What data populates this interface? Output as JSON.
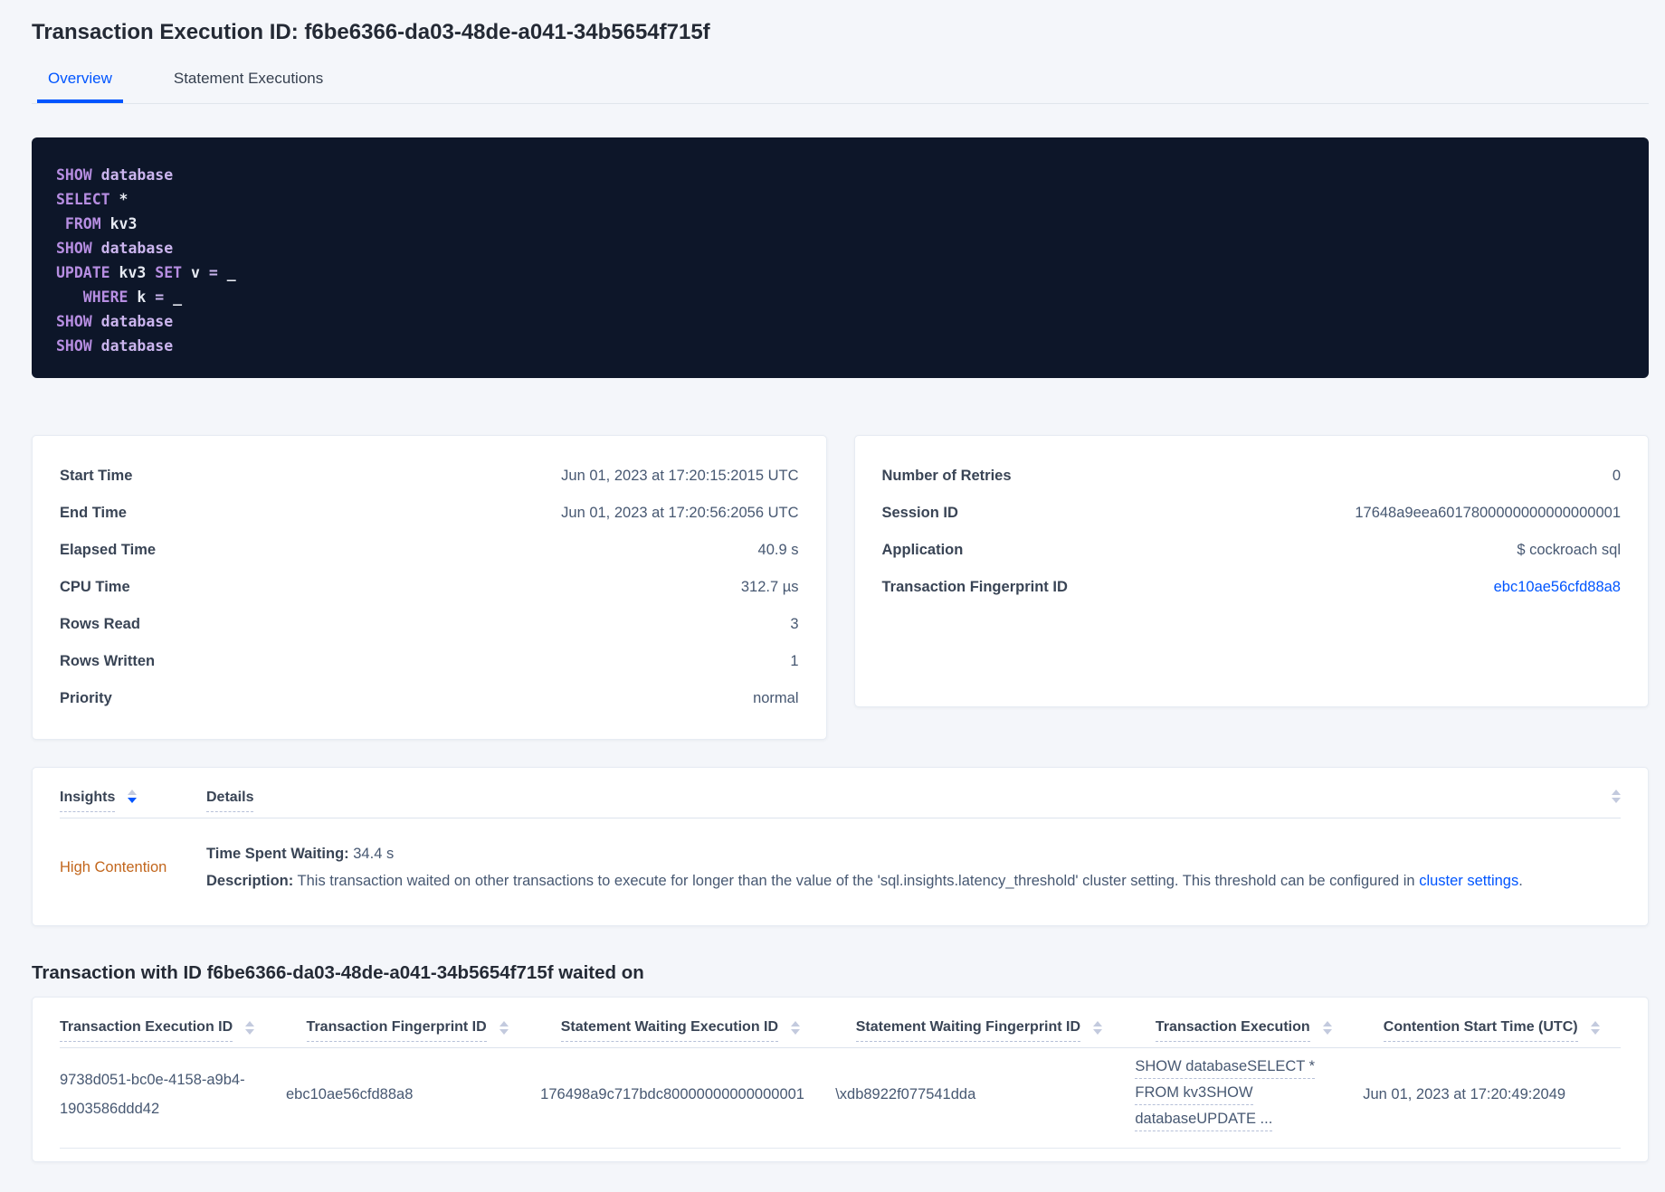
{
  "header": {
    "title": "Transaction Execution ID: f6be6366-da03-48de-a041-34b5654f715f"
  },
  "tabs": {
    "overview": "Overview",
    "statement_executions": "Statement Executions"
  },
  "sql": {
    "lines": [
      {
        "tokens": [
          {
            "t": "SHOW"
          },
          {
            "t": " database"
          }
        ]
      },
      {
        "tokens": [
          {
            "t": "SELECT"
          },
          {
            "t": " *"
          }
        ]
      },
      {
        "tokens": [
          {
            "t": " FROM"
          },
          {
            "t": " kv3"
          }
        ]
      },
      {
        "tokens": [
          {
            "t": "SHOW"
          },
          {
            "t": " database"
          }
        ]
      },
      {
        "tokens": [
          {
            "t": "UPDATE"
          },
          {
            "t": " kv3"
          },
          {
            "t": " SET"
          },
          {
            "t": " v"
          },
          {
            "t": " ="
          },
          {
            "t": " _"
          }
        ]
      },
      {
        "tokens": [
          {
            "t": "   WHERE"
          },
          {
            "t": " k"
          },
          {
            "t": " ="
          },
          {
            "t": " _"
          }
        ]
      },
      {
        "tokens": [
          {
            "t": "SHOW"
          },
          {
            "t": " database"
          }
        ]
      },
      {
        "tokens": [
          {
            "t": "SHOW"
          },
          {
            "t": " database"
          }
        ]
      }
    ]
  },
  "summary_left": {
    "rows": [
      {
        "label": "Start Time",
        "value": "Jun 01, 2023 at 17:20:15:2015 UTC"
      },
      {
        "label": "End Time",
        "value": "Jun 01, 2023 at 17:20:56:2056 UTC"
      },
      {
        "label": "Elapsed Time",
        "value": "40.9 s"
      },
      {
        "label": "CPU Time",
        "value": "312.7 µs"
      },
      {
        "label": "Rows Read",
        "value": "3"
      },
      {
        "label": "Rows Written",
        "value": "1"
      },
      {
        "label": "Priority",
        "value": "normal"
      }
    ]
  },
  "summary_right": {
    "rows": [
      {
        "label": "Number of Retries",
        "value": "0"
      },
      {
        "label": "Session ID",
        "value": "17648a9eea6017800000000000000001"
      },
      {
        "label": "Application",
        "value": "$ cockroach sql"
      },
      {
        "label": "Transaction Fingerprint ID",
        "value": "ebc10ae56cfd88a8"
      }
    ]
  },
  "insights": {
    "headers": {
      "insights": "Insights",
      "details": "Details"
    },
    "row": {
      "insight": "High Contention",
      "waiting_label": "Time Spent Waiting:",
      "waiting_value": " 34.4 s",
      "description_label": "Description:",
      "description_text": " This transaction waited on other transactions to execute for longer than the value of the 'sql.insights.latency_threshold' cluster setting. This threshold can be configured in ",
      "description_link": "cluster settings",
      "description_end": "."
    }
  },
  "waited_on": {
    "heading": "Transaction with ID f6be6366-da03-48de-a041-34b5654f715f waited on",
    "columns": [
      "Transaction Execution ID",
      "Transaction Fingerprint ID",
      "Statement Waiting Execution ID",
      "Statement Waiting Fingerprint ID",
      "Transaction Execution",
      "Contention Start Time (UTC)"
    ],
    "row": {
      "transaction_execution_id": "9738d051-bc0e-4158-a9b4-1903586ddd42",
      "transaction_fingerprint_id": "ebc10ae56cfd88a8",
      "statement_waiting_execution_id": "176498a9c717bdc80000000000000001",
      "statement_waiting_fingerprint_id": "\\xdb8922f077541dda",
      "transaction_execution_lines": [
        "SHOW databaseSELECT *",
        "FROM kv3SHOW",
        "databaseUPDATE ..."
      ],
      "contention_start_time": "Jun 01, 2023 at 17:20:49:2049"
    }
  },
  "icons": {
    "sort": "sort-arrows-icon"
  },
  "colors": {
    "accent_link": "#0055ff",
    "high_contention": "#c2661c",
    "code_background": "#0d1629",
    "code_keyword": "#b78ee2",
    "code_keyword_secondary": "#cbb5ee",
    "code_text": "#e6eaf2"
  }
}
